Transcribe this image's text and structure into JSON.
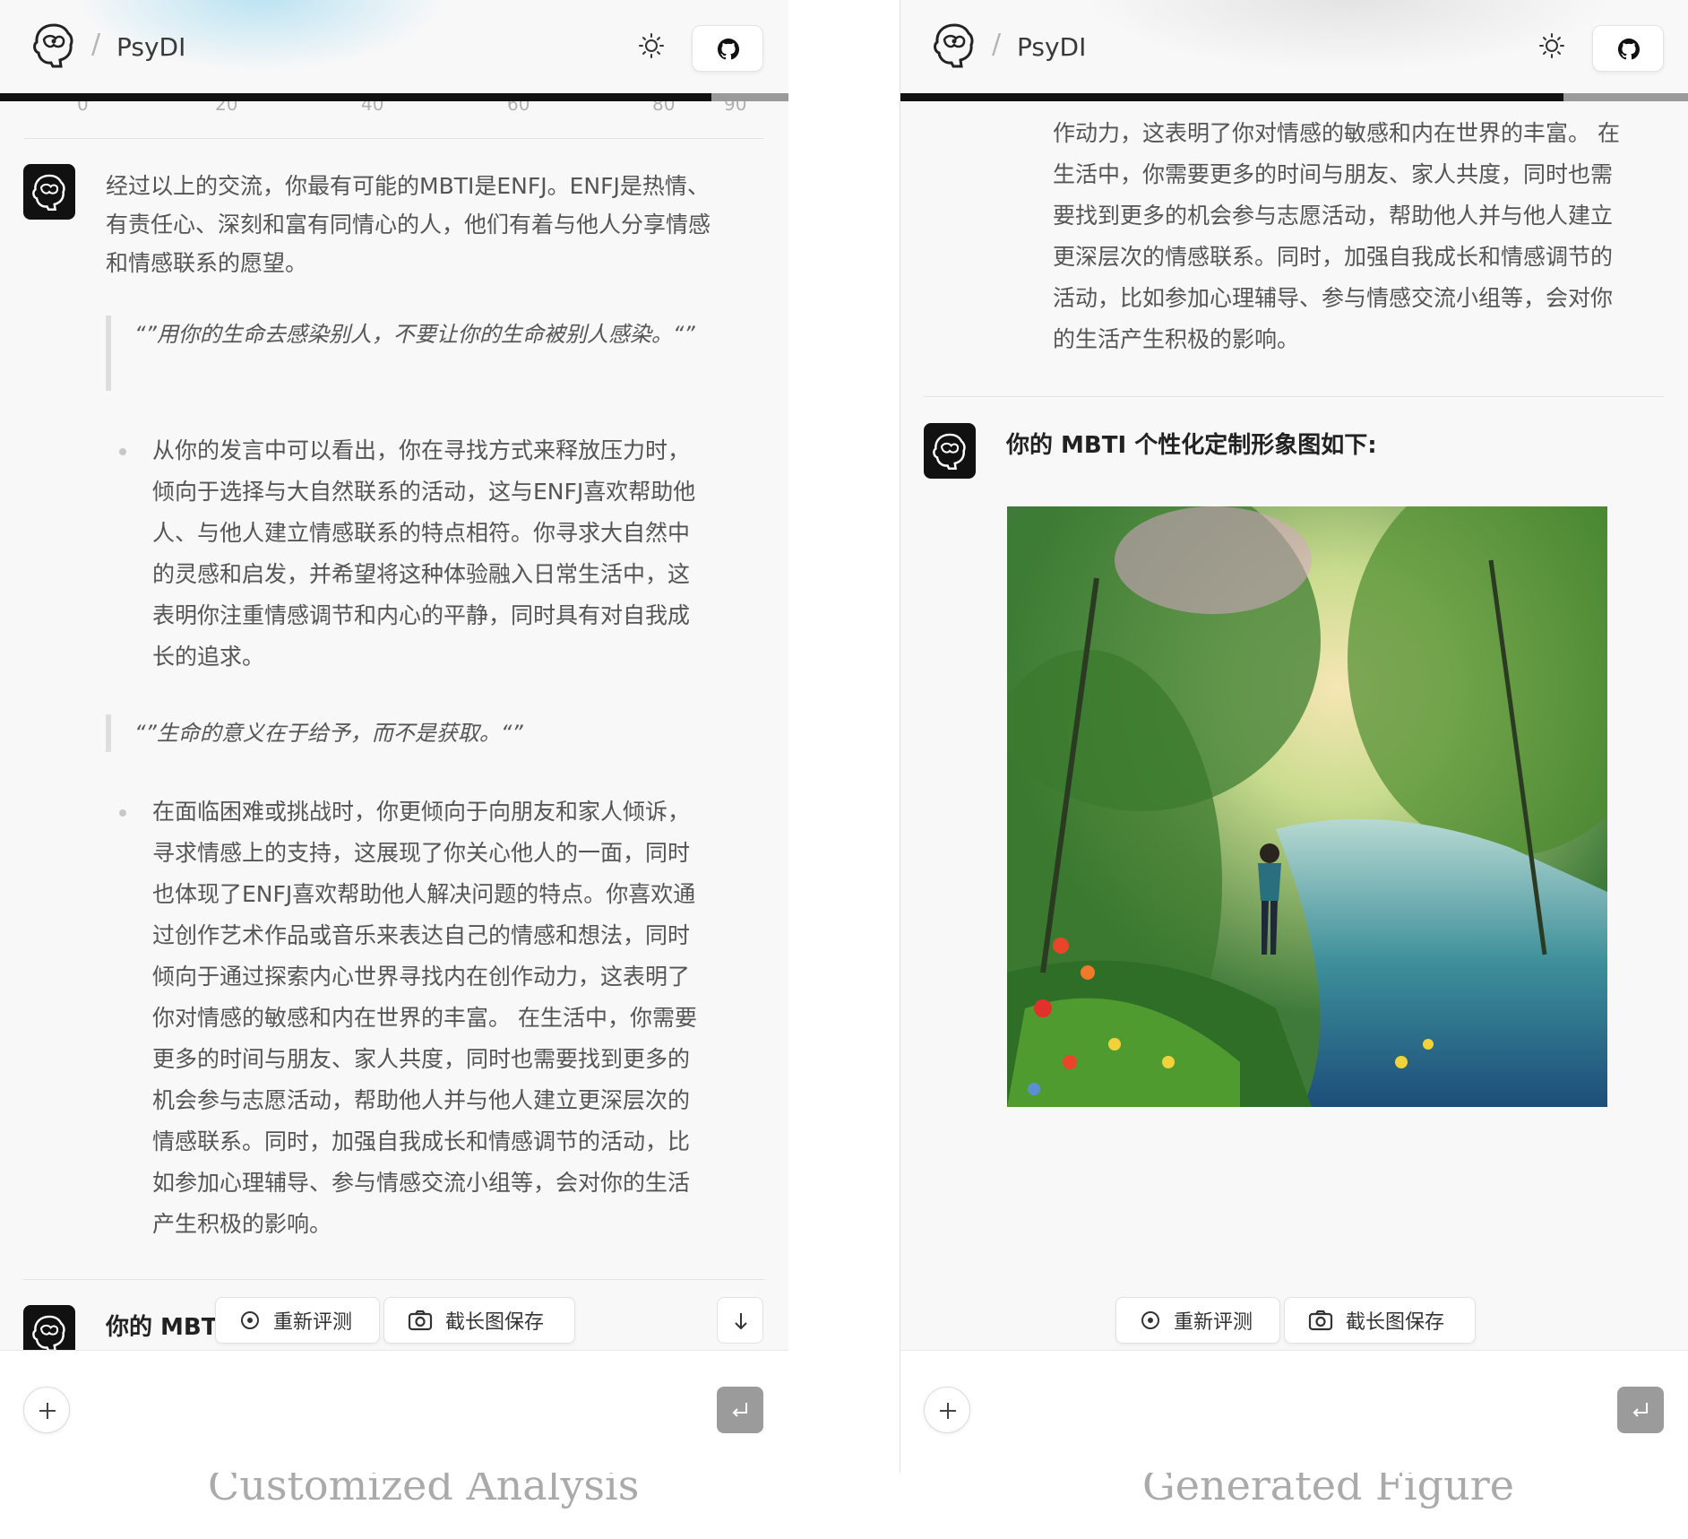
{
  "app": {
    "name": "PsyDI"
  },
  "left_panel": {
    "ticks": [
      "0",
      "20",
      "40",
      "60",
      "80",
      "90"
    ],
    "intro": "经过以上的交流，你最有可能的MBTI是ENFJ。ENFJ是热情、有责任心、深刻和富有同情心的人，他们有着与他人分享情感和情感联系的愿望。",
    "quote1": "“”用你的生命去感染别人，不要让你的生命被别人感染。“”",
    "bullet1": "从你的发言中可以看出，你在寻找方式来释放压力时，倾向于选择与大自然联系的活动，这与ENFJ喜欢帮助他人、与他人建立情感联系的特点相符。你寻求大自然中的灵感和启发，并希望将这种体验融入日常生活中，这表明你注重情感调节和内心的平静，同时具有对自我成长的追求。",
    "quote2": "“”生命的意义在于给予，而不是获取。“”",
    "bullet2": "在面临困难或挑战时，你更倾向于向朋友和家人倾诉，寻求情感上的支持，这展现了你关心他人的一面，同时也体现了ENFJ喜欢帮助他人解决问题的特点。你喜欢通过创作艺术作品或音乐来表达自己的情感和想法，同时倾向于通过探索内心世界寻找内在创作动力，这表明了你对情感的敏感和内在世界的丰富。 在生活中，你需要更多的时间与朋友、家人共度，同时也需要找到更多的机会参与志愿活动，帮助他人并与他人建立更深层次的情感联系。同时，加强自我成长和情感调节的活动，比如参加心理辅导、参与情感交流小组等，会对你的生活产生积极的影响。",
    "next_title": "你的 MBTI"
  },
  "right_panel": {
    "top_text": "作动力，这表明了你对情感的敏感和内在世界的丰富。 在生活中，你需要更多的时间与朋友、家人共度，同时也需要找到更多的机会参与志愿活动，帮助他人并与他人建立更深层次的情感联系。同时，加强自我成长和情感调节的活动，比如参加心理辅导、参与情感交流小组等，会对你的生活产生积极的影响。",
    "figure_title": "你的 MBTI 个性化定制形象图如下:"
  },
  "buttons": {
    "retest": "重新评测",
    "screenshot": "截长图保存"
  },
  "captions": {
    "left": "Customized Analysis",
    "right": "Generated Figure"
  },
  "icons": [
    "brain-logo-icon",
    "sun-icon",
    "github-icon",
    "target-icon",
    "camera-icon",
    "arrow-down-icon",
    "plus-icon",
    "enter-icon"
  ]
}
